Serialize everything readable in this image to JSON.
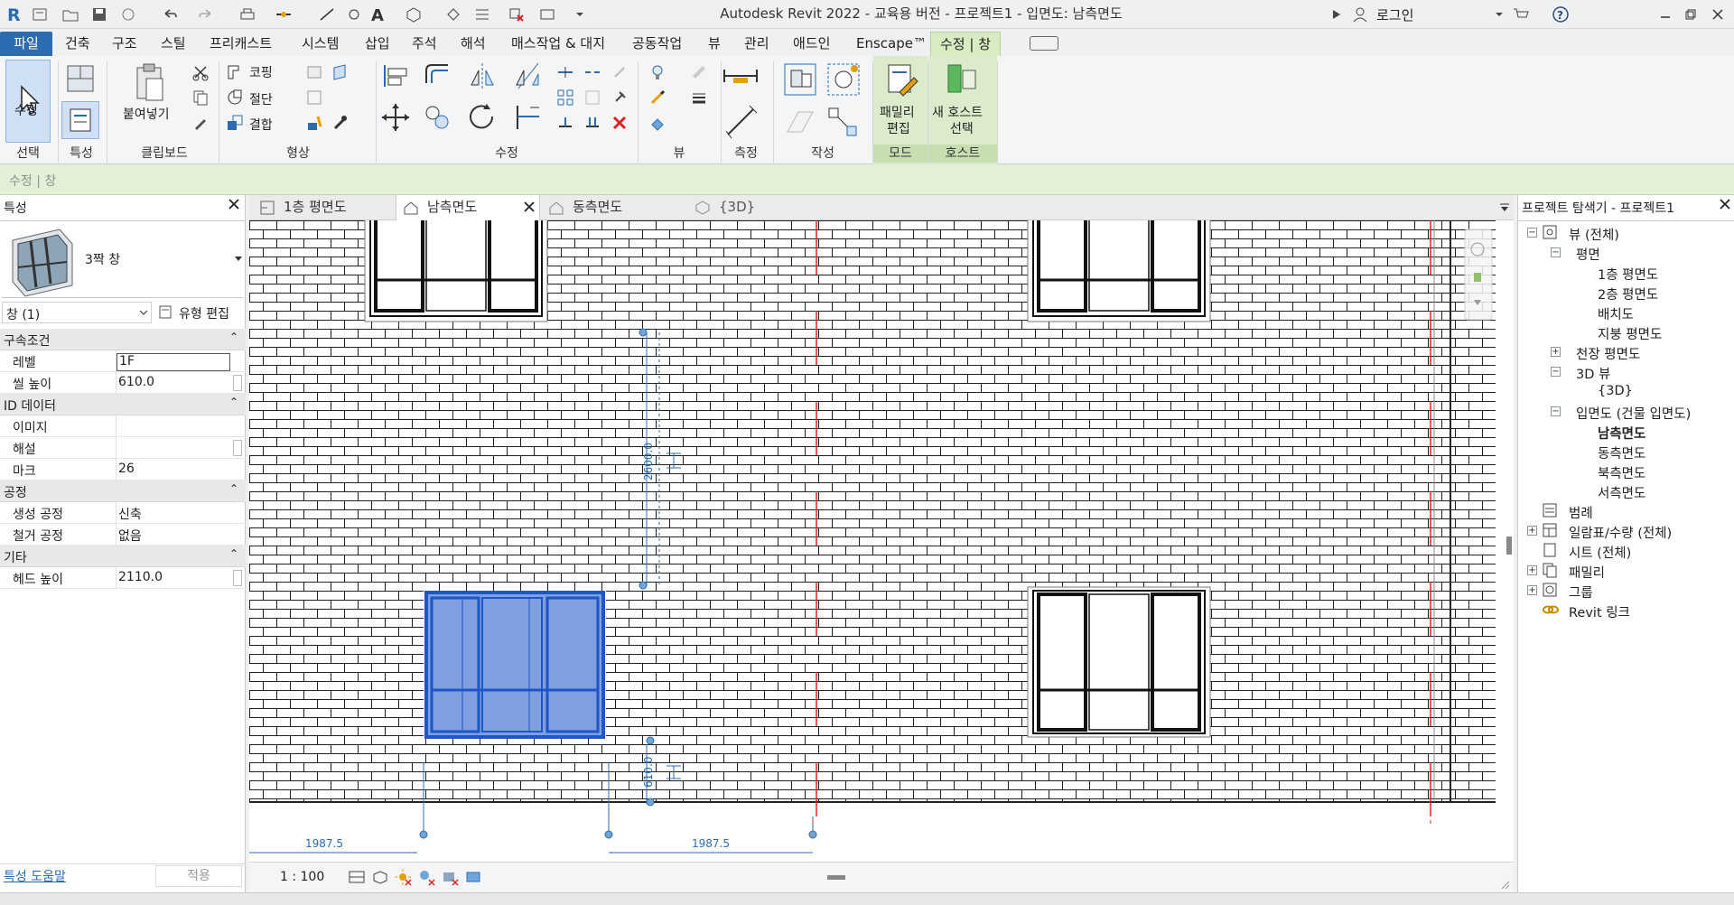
{
  "window": {
    "title": "Autodesk Revit 2022 - 교육용 버전 - 프로젝트1 - 입면도: 남측면도",
    "login_label": "로그인"
  },
  "menu": {
    "tabs": [
      "파일",
      "건축",
      "구조",
      "스틸",
      "프리캐스트",
      "시스템",
      "삽입",
      "주석",
      "해석",
      "매스작업 & 대지",
      "공동작업",
      "뷰",
      "관리",
      "애드인",
      "Enscape™",
      "수정 | 창"
    ]
  },
  "ribbon": {
    "select_label": "선택",
    "modify_label": "수정",
    "properties_label": "특성",
    "clipboard_label": "클립보드",
    "paste_label": "붙여넣기",
    "geometry_label": "형상",
    "cope_label": "코핑",
    "cut_label": "절단",
    "join_label": "결합",
    "modify_panel_label": "수정",
    "view_label": "뷰",
    "measure_label": "측정",
    "create_label": "작성",
    "mode_label": "모드",
    "host_label": "호스트",
    "edit_family_label_1": "패밀리",
    "edit_family_label_2": "편집",
    "pick_host_label_1": "새 호스트",
    "pick_host_label_2": "선택"
  },
  "context_bar": {
    "text": "수정 | 창"
  },
  "properties": {
    "title": "특성",
    "type_name": "3짝 창",
    "instance_filter": "창 (1)",
    "edit_type_label": "유형 편집",
    "sections": [
      {
        "title": "구속조건",
        "rows": [
          {
            "key": "레벨",
            "value": "1F"
          },
          {
            "key": "씰 높이",
            "value": "610.0"
          }
        ]
      },
      {
        "title": "ID 데이터",
        "rows": [
          {
            "key": "이미지",
            "value": ""
          },
          {
            "key": "해설",
            "value": ""
          },
          {
            "key": "마크",
            "value": "26"
          }
        ]
      },
      {
        "title": "공정",
        "rows": [
          {
            "key": "생성 공정",
            "value": "신축"
          },
          {
            "key": "철거 공정",
            "value": "없음"
          }
        ]
      },
      {
        "title": "기타",
        "rows": [
          {
            "key": "헤드 높이",
            "value": "2110.0"
          }
        ]
      }
    ],
    "help_link": "특성 도움말",
    "apply_label": "적용"
  },
  "view_tabs": [
    {
      "label": "1층 평면도",
      "active": false
    },
    {
      "label": "남측면도",
      "active": true
    },
    {
      "label": "동측면도",
      "active": false
    },
    {
      "label": "{3D}",
      "active": false
    }
  ],
  "canvas": {
    "dim_upper": "2600.0",
    "dim_lower": "610.0",
    "dim_bottom_left": "1987.5",
    "dim_bottom_right": "1987.5"
  },
  "view_control": {
    "scale": "1 : 100"
  },
  "browser": {
    "title": "프로젝트 탐색기 - 프로젝트1",
    "nodes": [
      {
        "label": "뷰 (전체)",
        "level": 0,
        "toggle": "-"
      },
      {
        "label": "평면",
        "level": 1,
        "toggle": "-"
      },
      {
        "label": "1층 평면도",
        "level": 2
      },
      {
        "label": "2층 평면도",
        "level": 2
      },
      {
        "label": "배치도",
        "level": 2
      },
      {
        "label": "지붕 평면도",
        "level": 2
      },
      {
        "label": "천장 평면도",
        "level": 1,
        "toggle": "+"
      },
      {
        "label": "3D 뷰",
        "level": 1,
        "toggle": "-"
      },
      {
        "label": "{3D}",
        "level": 2
      },
      {
        "label": "입면도 (건물 입면도)",
        "level": 1,
        "toggle": "-"
      },
      {
        "label": "남측면도",
        "level": 2,
        "bold": true
      },
      {
        "label": "동측면도",
        "level": 2
      },
      {
        "label": "북측면도",
        "level": 2
      },
      {
        "label": "서측면도",
        "level": 2
      },
      {
        "label": "범례",
        "level": 0
      },
      {
        "label": "일람표/수량 (전체)",
        "level": 0,
        "toggle": "+"
      },
      {
        "label": "시트 (전체)",
        "level": 0
      },
      {
        "label": "패밀리",
        "level": 0,
        "toggle": "+"
      },
      {
        "label": "그룹",
        "level": 0,
        "toggle": "+"
      },
      {
        "label": "Revit 링크",
        "level": 0
      }
    ]
  },
  "colors": {
    "accent": "#2b6cb0",
    "context_green": "#d8ecc4",
    "selection_blue": "#1e56c8",
    "selection_fill": "#7f9fe0"
  }
}
